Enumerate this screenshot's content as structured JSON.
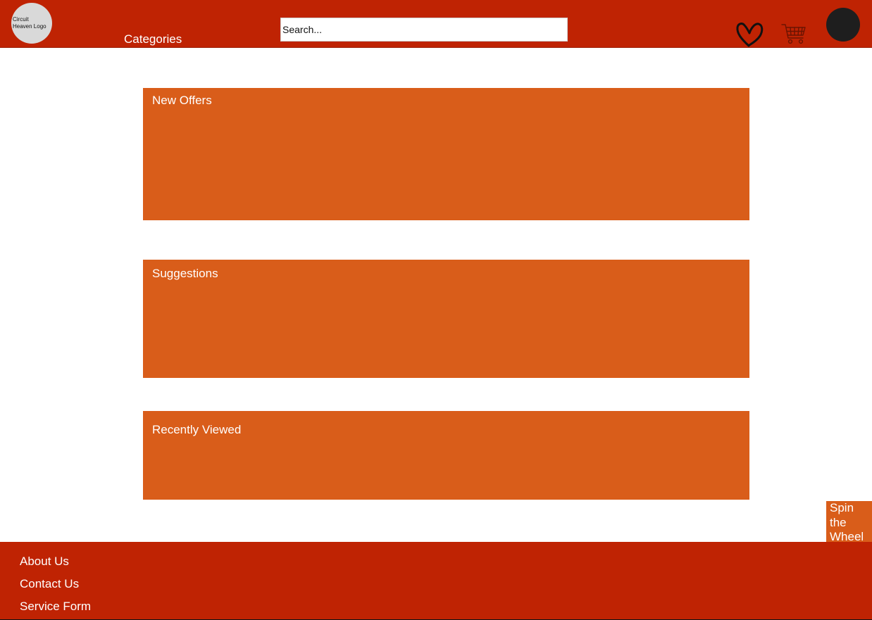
{
  "header": {
    "logo_text": "Circuit\nHeaven Logo",
    "categories_label": "Categories",
    "search": {
      "placeholder": "Search...",
      "value": ""
    },
    "icons": {
      "wishlist": "heart-icon",
      "cart": "cart-icon",
      "account": "avatar"
    }
  },
  "main": {
    "sections": [
      {
        "title": "New Offers"
      },
      {
        "title": "Suggestions"
      },
      {
        "title": "Recently Viewed"
      }
    ]
  },
  "spin_wheel": {
    "label": "Spin the Wheel"
  },
  "footer": {
    "links": [
      "About Us",
      "Contact Us",
      "Service Form"
    ]
  },
  "colors": {
    "header_footer": "#bf2303",
    "section": "#d95d1a",
    "avatar": "#1e1e1e",
    "logo": "#d9d9d9"
  }
}
